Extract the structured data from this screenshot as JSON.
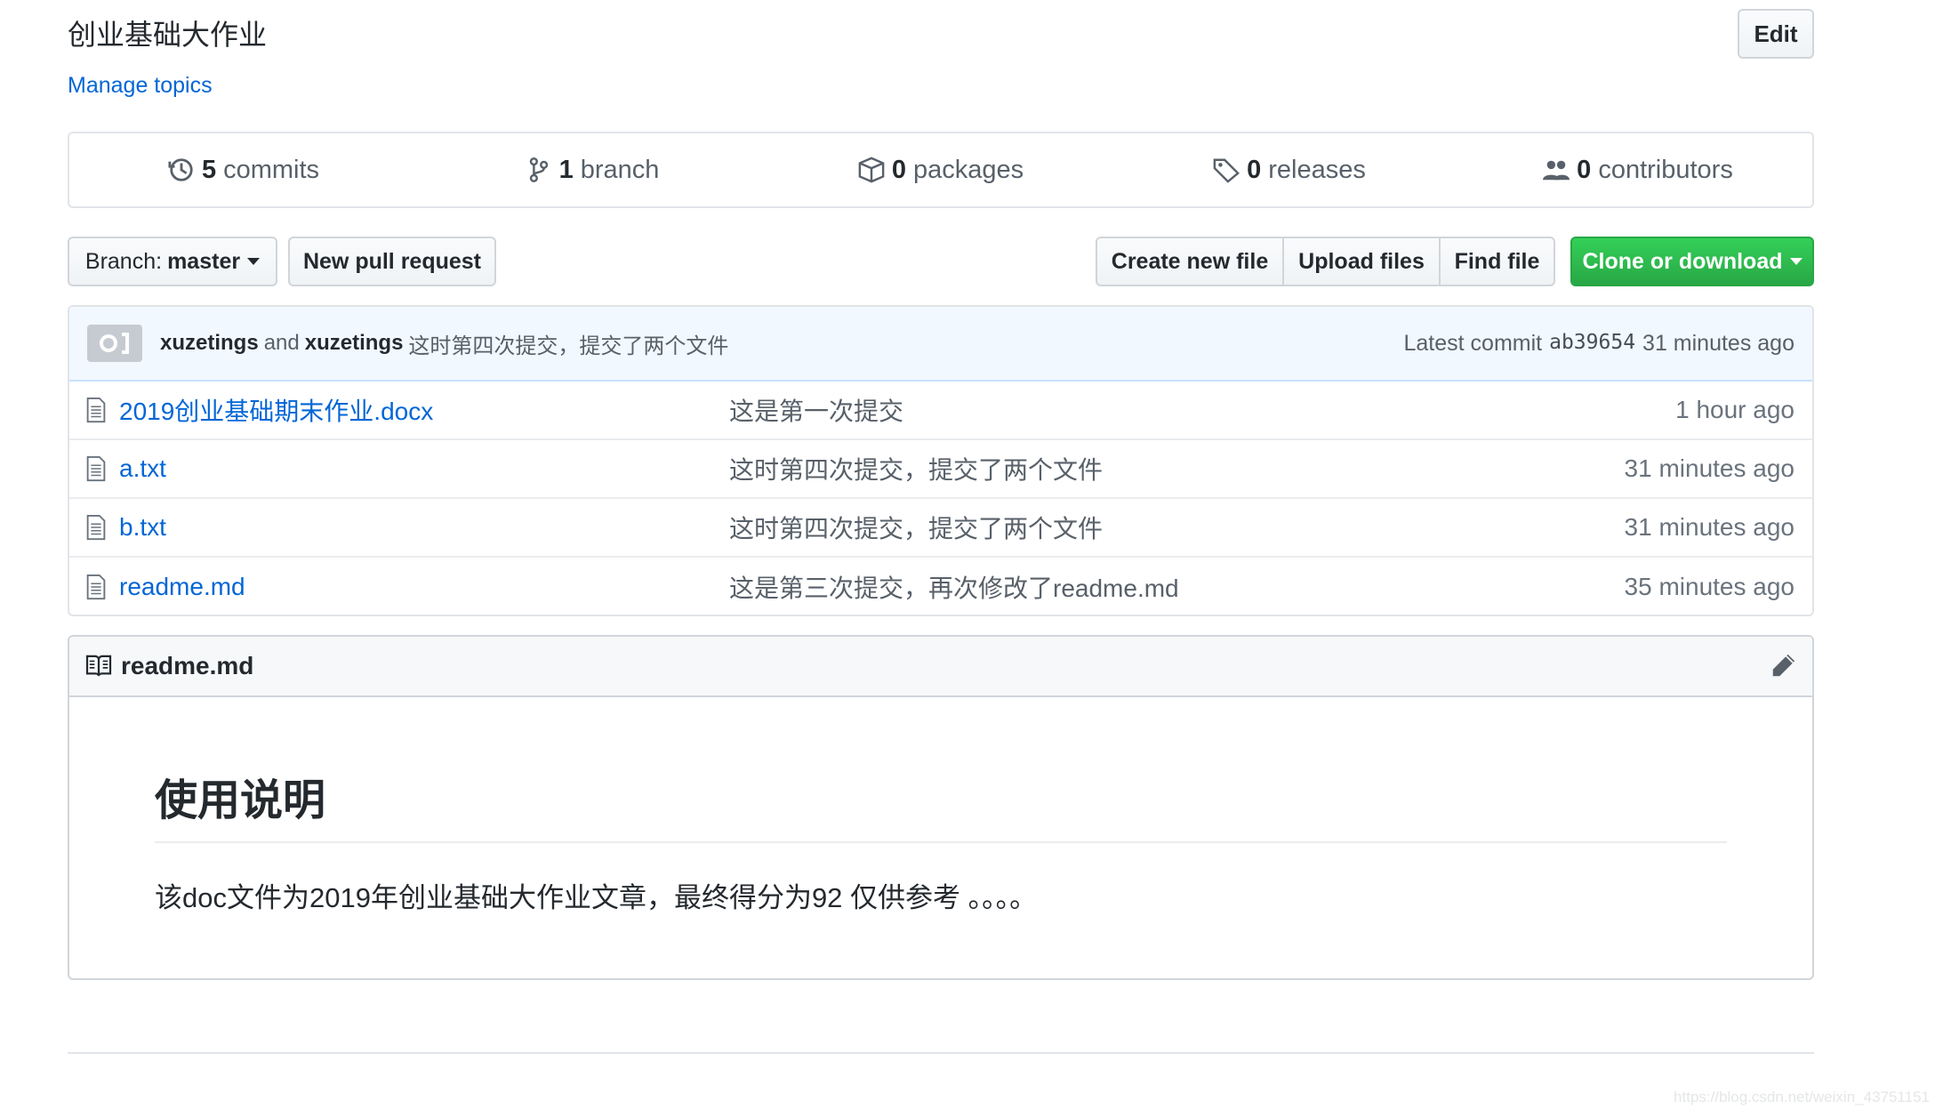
{
  "repo": {
    "description": "创业基础大作业",
    "edit_label": "Edit",
    "manage_topics": "Manage topics"
  },
  "summary": {
    "commits_count": "5",
    "commits_label": "commits",
    "branch_count": "1",
    "branch_label": "branch",
    "packages_count": "0",
    "packages_label": "packages",
    "releases_count": "0",
    "releases_label": "releases",
    "contributors_count": "0",
    "contributors_label": "contributors"
  },
  "toolbar": {
    "branch_prefix": "Branch:",
    "branch_name": "master",
    "new_pr": "New pull request",
    "create_file": "Create new file",
    "upload_files": "Upload files",
    "find_file": "Find file",
    "clone": "Clone or download"
  },
  "commit": {
    "author1": "xuzetings",
    "and": "and",
    "author2": "xuzetings",
    "message": "这时第四次提交，提交了两个文件",
    "latest_label": "Latest commit",
    "sha": "ab39654",
    "age": "31 minutes ago"
  },
  "files": [
    {
      "name": "2019创业基础期末作业.docx",
      "message": "这是第一次提交",
      "age": "1 hour ago"
    },
    {
      "name": "a.txt",
      "message": "这时第四次提交，提交了两个文件",
      "age": "31 minutes ago"
    },
    {
      "name": "b.txt",
      "message": "这时第四次提交，提交了两个文件",
      "age": "31 minutes ago"
    },
    {
      "name": "readme.md",
      "message": "这是第三次提交，再次修改了readme.md",
      "age": "35 minutes ago"
    }
  ],
  "readme": {
    "filename": "readme.md",
    "heading": "使用说明",
    "body": "该doc文件为2019年创业基础大作业文章，最终得分为92 仅供参考 。。。。"
  },
  "watermark": "https://blog.csdn.net/weixin_43751151",
  "colors": {
    "link": "#0366d6",
    "clone_green": "#28a745",
    "commit_bar": "#f1f8ff"
  }
}
